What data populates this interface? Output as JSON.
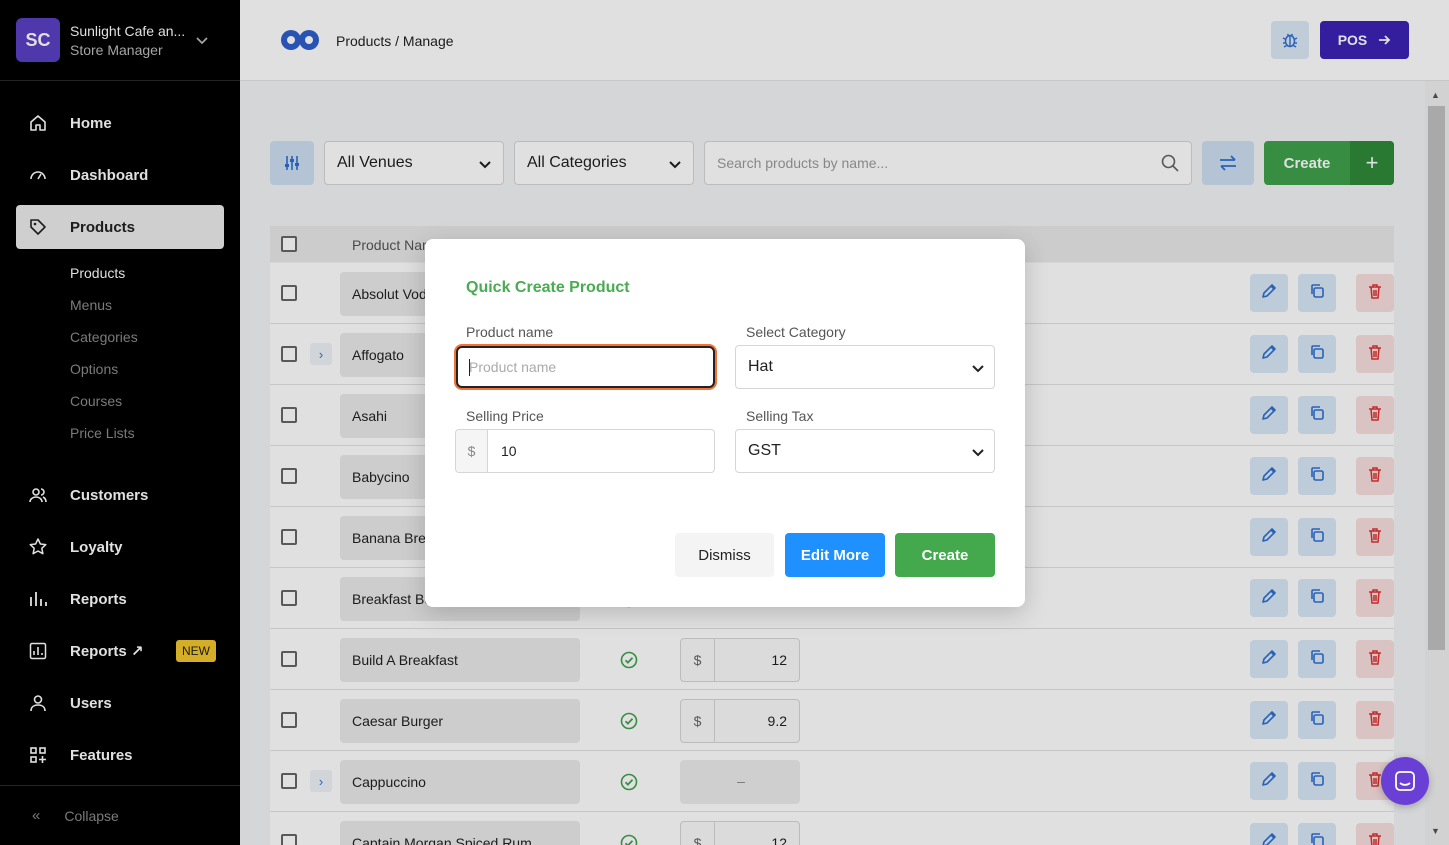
{
  "store": {
    "initials": "SC",
    "name": "Sunlight Cafe an...",
    "role": "Store Manager"
  },
  "nav": {
    "home": "Home",
    "dashboard": "Dashboard",
    "products": "Products",
    "customers": "Customers",
    "loyalty": "Loyalty",
    "reports": "Reports",
    "reports_new": "Reports ↗",
    "new_badge": "NEW",
    "users": "Users",
    "features": "Features",
    "collapse": "Collapse"
  },
  "subnav": [
    "Products",
    "Menus",
    "Categories",
    "Options",
    "Courses",
    "Price Lists"
  ],
  "header": {
    "breadcrumb": "Products / Manage",
    "pos_label": "POS"
  },
  "toolbar": {
    "venue": "All Venues",
    "category": "All Categories",
    "search_placeholder": "Search products by name...",
    "create_label": "Create",
    "create_plus": "+"
  },
  "table": {
    "col_product_name": "Product Name",
    "rows": [
      {
        "name": "Absolut Vodka",
        "expand": false,
        "active": true,
        "price": ""
      },
      {
        "name": "Affogato",
        "expand": true,
        "active": true,
        "price": ""
      },
      {
        "name": "Asahi",
        "expand": false,
        "active": true,
        "price": ""
      },
      {
        "name": "Babycino",
        "expand": false,
        "active": true,
        "price": ""
      },
      {
        "name": "Banana Bread",
        "expand": false,
        "active": true,
        "price": ""
      },
      {
        "name": "Breakfast Burger",
        "expand": false,
        "active": true,
        "price": ""
      },
      {
        "name": "Build A Breakfast",
        "expand": false,
        "active": true,
        "price": "12"
      },
      {
        "name": "Caesar Burger",
        "expand": false,
        "active": true,
        "price": "9.2"
      },
      {
        "name": "Cappuccino",
        "expand": true,
        "active": true,
        "price": "–"
      },
      {
        "name": "Captain Morgan Spiced Rum",
        "expand": false,
        "active": true,
        "price": "12"
      }
    ]
  },
  "modal": {
    "title": "Quick Create Product",
    "product_name_label": "Product name",
    "product_name_placeholder": "Product name",
    "category_label": "Select Category",
    "category_value": "Hat",
    "price_label": "Selling Price",
    "currency": "$",
    "price_value": "10",
    "tax_label": "Selling Tax",
    "tax_value": "GST",
    "dismiss": "Dismiss",
    "edit_more": "Edit More",
    "create": "Create"
  },
  "colors": {
    "accent_green": "#43a94c",
    "accent_blue": "#1e90ff",
    "brand_purple": "#3d23b3",
    "sidebar": "#000000"
  }
}
